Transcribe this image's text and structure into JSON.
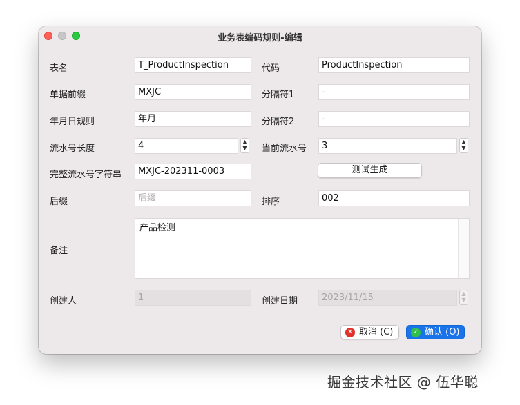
{
  "window": {
    "title": "业务表编码规则-编辑"
  },
  "form": {
    "table_name": {
      "label": "表名",
      "value": "T_ProductInspection"
    },
    "code": {
      "label": "代码",
      "value": "ProductInspection"
    },
    "prefix": {
      "label": "单据前缀",
      "value": "MXJC"
    },
    "separator1": {
      "label": "分隔符1",
      "value": "-"
    },
    "date_rule": {
      "label": "年月日规则",
      "value": "年月"
    },
    "separator2": {
      "label": "分隔符2",
      "value": "-"
    },
    "serial_length": {
      "label": "流水号长度",
      "value": "4"
    },
    "current_serial": {
      "label": "当前流水号",
      "value": "3"
    },
    "full_serial": {
      "label": "完整流水号字符串",
      "value": "MXJC-202311-0003"
    },
    "suffix": {
      "label": "后缀",
      "value": "",
      "placeholder": "后缀"
    },
    "sort": {
      "label": "排序",
      "value": "002"
    },
    "remark": {
      "label": "备注",
      "value": "产品检测"
    },
    "creator": {
      "label": "创建人",
      "value": "1"
    },
    "create_date": {
      "label": "创建日期",
      "value": "2023/11/15"
    }
  },
  "buttons": {
    "test_generate": "测试生成",
    "cancel": "取消 (C)",
    "confirm": "确认 (O)"
  },
  "watermark": "掘金技术社区 @ 伍华聪",
  "colors": {
    "primary": "#1a73e8",
    "close": "#ff5f57",
    "maximize": "#28c840"
  }
}
